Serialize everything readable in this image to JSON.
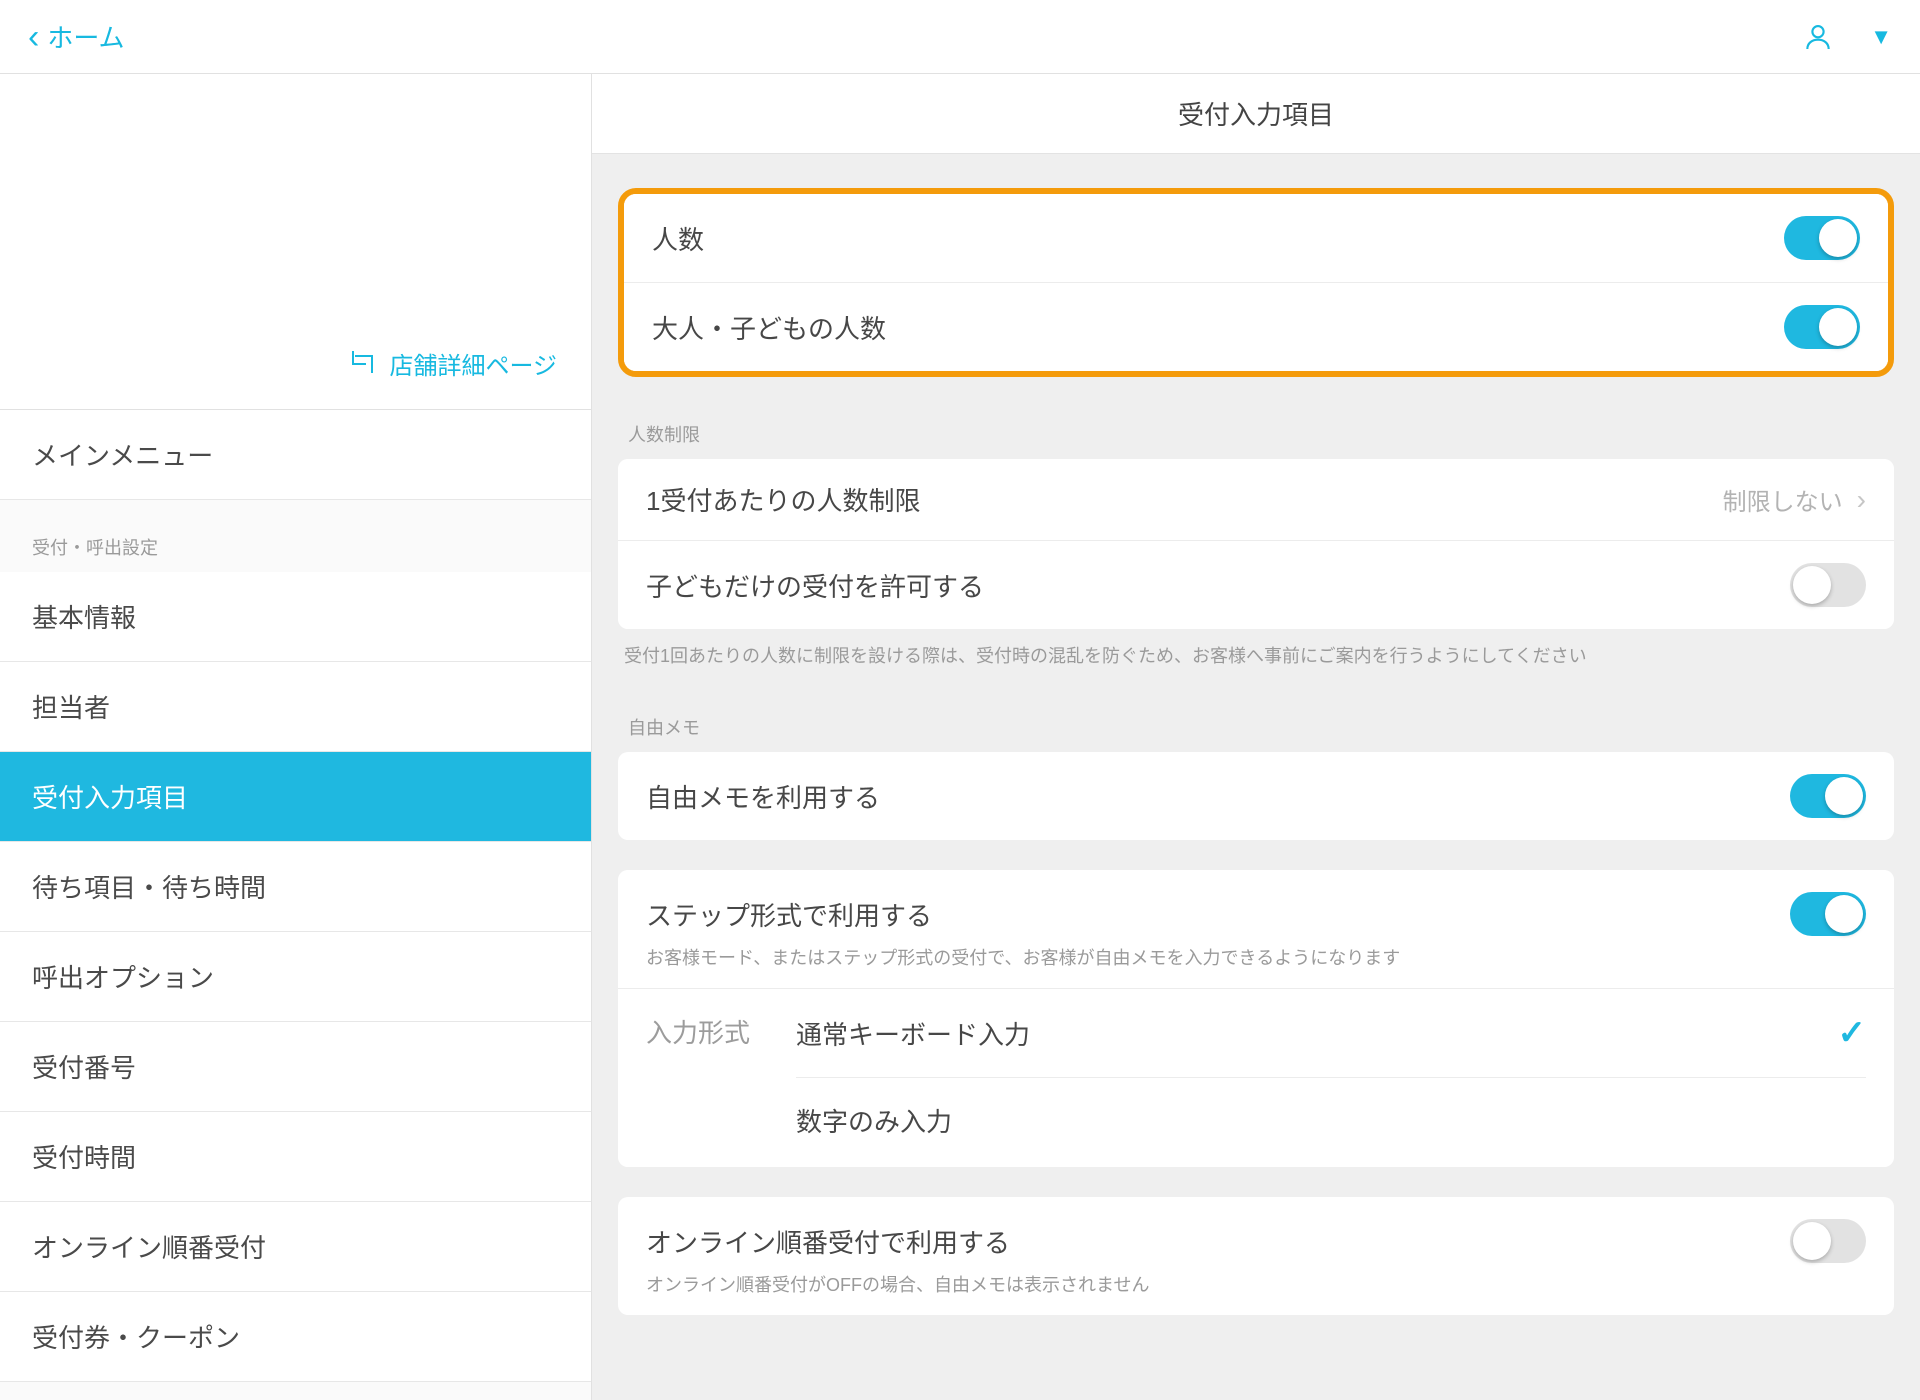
{
  "header": {
    "back_label": "ホーム"
  },
  "sidebar": {
    "store_detail_link": "店舗詳細ページ",
    "main_menu_label": "メインメニュー",
    "section_label": "受付・呼出設定",
    "items": [
      "基本情報",
      "担当者",
      "受付入力項目",
      "待ち項目・待ち時間",
      "呼出オプション",
      "受付番号",
      "受付時間",
      "オンライン順番受付",
      "受付券・クーポン"
    ],
    "active_index": 2
  },
  "main": {
    "title": "受付入力項目",
    "people": {
      "count_label": "人数",
      "adult_child_label": "大人・子どもの人数"
    },
    "limit": {
      "caption": "人数制限",
      "per_reception_label": "1受付あたりの人数制限",
      "per_reception_value": "制限しない",
      "allow_children_only_label": "子どもだけの受付を許可する",
      "note": "受付1回あたりの人数に制限を設ける際は、受付時の混乱を防ぐため、お客様へ事前にご案内を行うようにしてください"
    },
    "memo": {
      "caption": "自由メモ",
      "use_memo_label": "自由メモを利用する",
      "step_label": "ステップ形式で利用する",
      "step_note": "お客様モード、またはステップ形式の受付で、お客様が自由メモを入力できるようになります",
      "format_label": "入力形式",
      "format_opt_keyboard": "通常キーボード入力",
      "format_opt_numeric": "数字のみ入力",
      "online_label": "オンライン順番受付で利用する",
      "online_note": "オンライン順番受付がOFFの場合、自由メモは表示されません"
    }
  }
}
